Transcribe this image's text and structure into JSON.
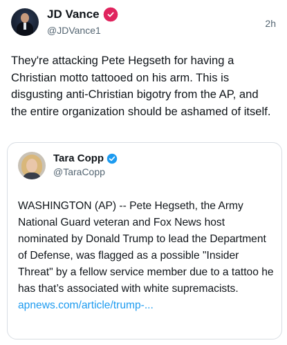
{
  "post": {
    "author_name": "JD Vance",
    "author_handle": "@JDVance1",
    "time": "2h",
    "verified_badge_color": "#e0245e",
    "text": "They're attacking Pete Hegseth for having a Christian motto tattooed on his arm. This is disgusting anti-Christian bigotry from the AP, and the entire organization should be ashamed of itself."
  },
  "quoted": {
    "author_name": "Tara Copp",
    "author_handle": "@TaraCopp",
    "verified_badge_color": "#1d9bf0",
    "text": "WASHINGTON (AP) -- Pete Hegseth, the Army National Guard veteran and Fox News host nominated by Donald Trump to lead the Department of Defense, was flagged as a possible \"Insider Threat\" by a fellow service member due to a tattoo he has that’s associated with white supremacists.",
    "link_text": "apnews.com/article/trump-..."
  }
}
